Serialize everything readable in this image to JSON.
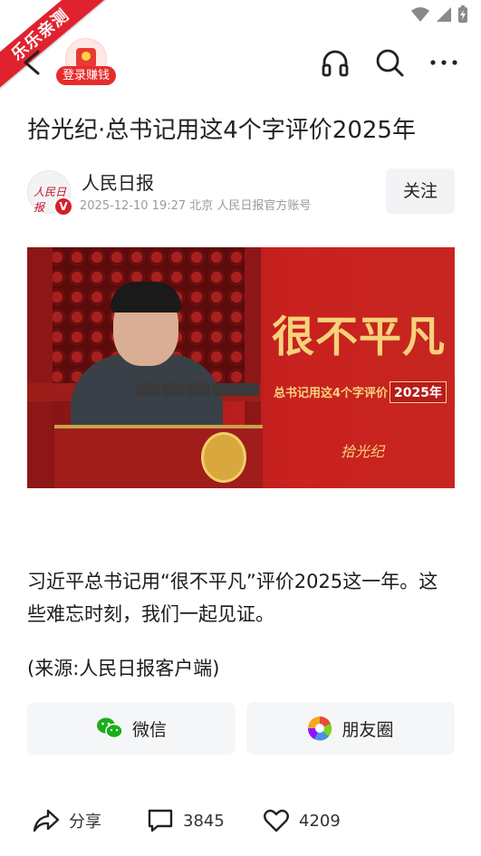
{
  "ribbon": {
    "label": "乐乐亲测"
  },
  "header": {
    "login_badge": "登录赚钱"
  },
  "article": {
    "title": "拾光纪·总书记用这4个字评价2025年",
    "author": {
      "name": "人民日报",
      "meta": "2025-12-10   19:27   北京   人民日报官方账号",
      "avatar_text": "人民日报",
      "verified_mark": "V"
    },
    "follow_label": "关注",
    "hero": {
      "headline": "很不平凡",
      "subline": "总书记用这4个字评价",
      "year": "2025年",
      "seal": "拾光纪"
    },
    "paragraph": "习近平总书记用“很不平凡”评价2025这一年。这些难忘时刻，我们一起见证。",
    "source": "(来源:人民日报客户端)"
  },
  "share": {
    "wechat_label": "微信",
    "moments_label": "朋友圈"
  },
  "bottom": {
    "share_label": "分享",
    "comment_count": "3845",
    "like_count": "4209"
  },
  "colors": {
    "brand_red": "#e62c2c",
    "wechat_green": "#1aad19",
    "hero_gold": "#f6d27a"
  }
}
